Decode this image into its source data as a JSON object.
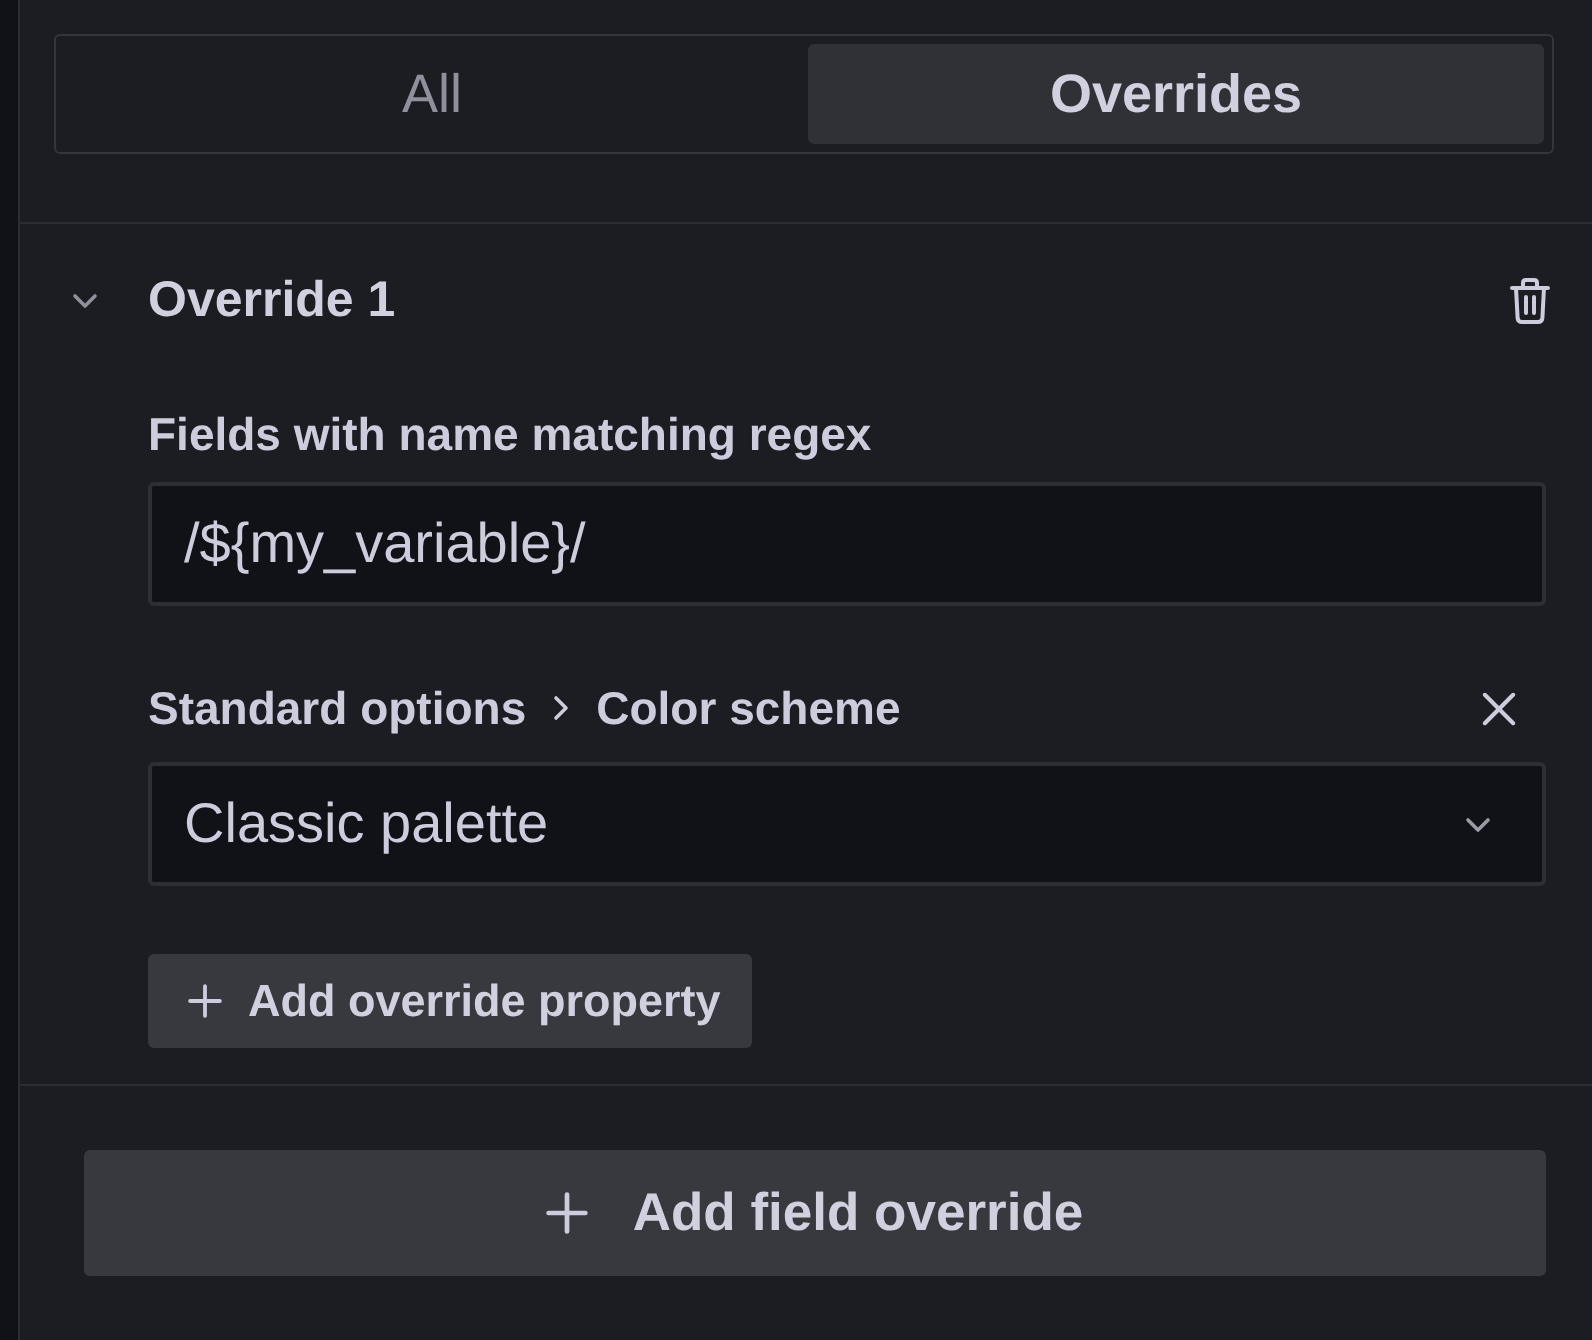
{
  "tabs": [
    {
      "label": "All",
      "selected": false
    },
    {
      "label": "Overrides",
      "selected": true
    }
  ],
  "override": {
    "title": "Override 1",
    "expanded": true,
    "matcher": {
      "label": "Fields with name matching regex",
      "value": "/${my_variable}/"
    },
    "properties": [
      {
        "path": [
          "Standard options",
          "Color scheme"
        ],
        "value": "Classic palette"
      }
    ],
    "add_property_button": "Add override property"
  },
  "add_override_button": "Add field override"
}
